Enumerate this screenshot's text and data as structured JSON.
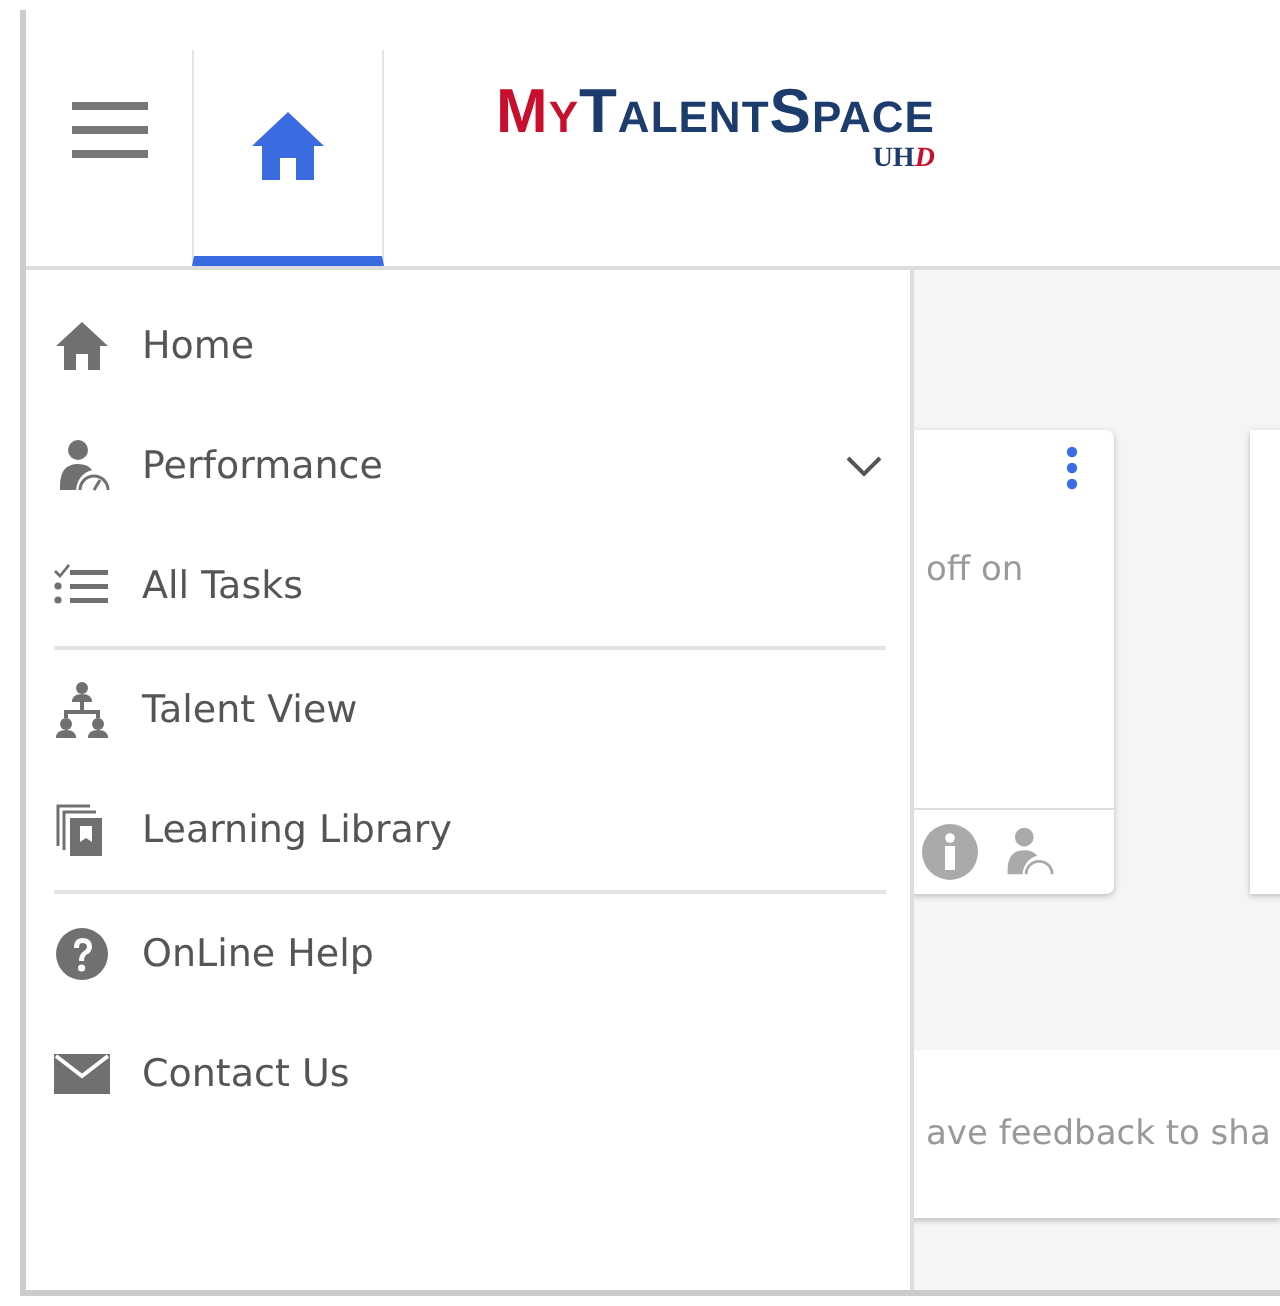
{
  "header": {
    "home_tab": {
      "selected": true
    },
    "logo": {
      "brand_first": "My",
      "brand_rest": "TalentSpace",
      "sub_first": "UH",
      "sub_rest": "D"
    }
  },
  "menu": {
    "groups": [
      [
        {
          "label": "Home",
          "kind": "link"
        },
        {
          "label": "Performance",
          "kind": "submenu"
        },
        {
          "label": "All Tasks",
          "kind": "link"
        }
      ],
      [
        {
          "label": "Talent View",
          "kind": "link"
        },
        {
          "label": "Learning Library",
          "kind": "link"
        }
      ],
      [
        {
          "label": "OnLine Help",
          "kind": "link"
        },
        {
          "label": "Contact Us",
          "kind": "link"
        }
      ]
    ]
  },
  "background": {
    "card_text": "off on",
    "feedback_text": "ave feedback to sha"
  }
}
